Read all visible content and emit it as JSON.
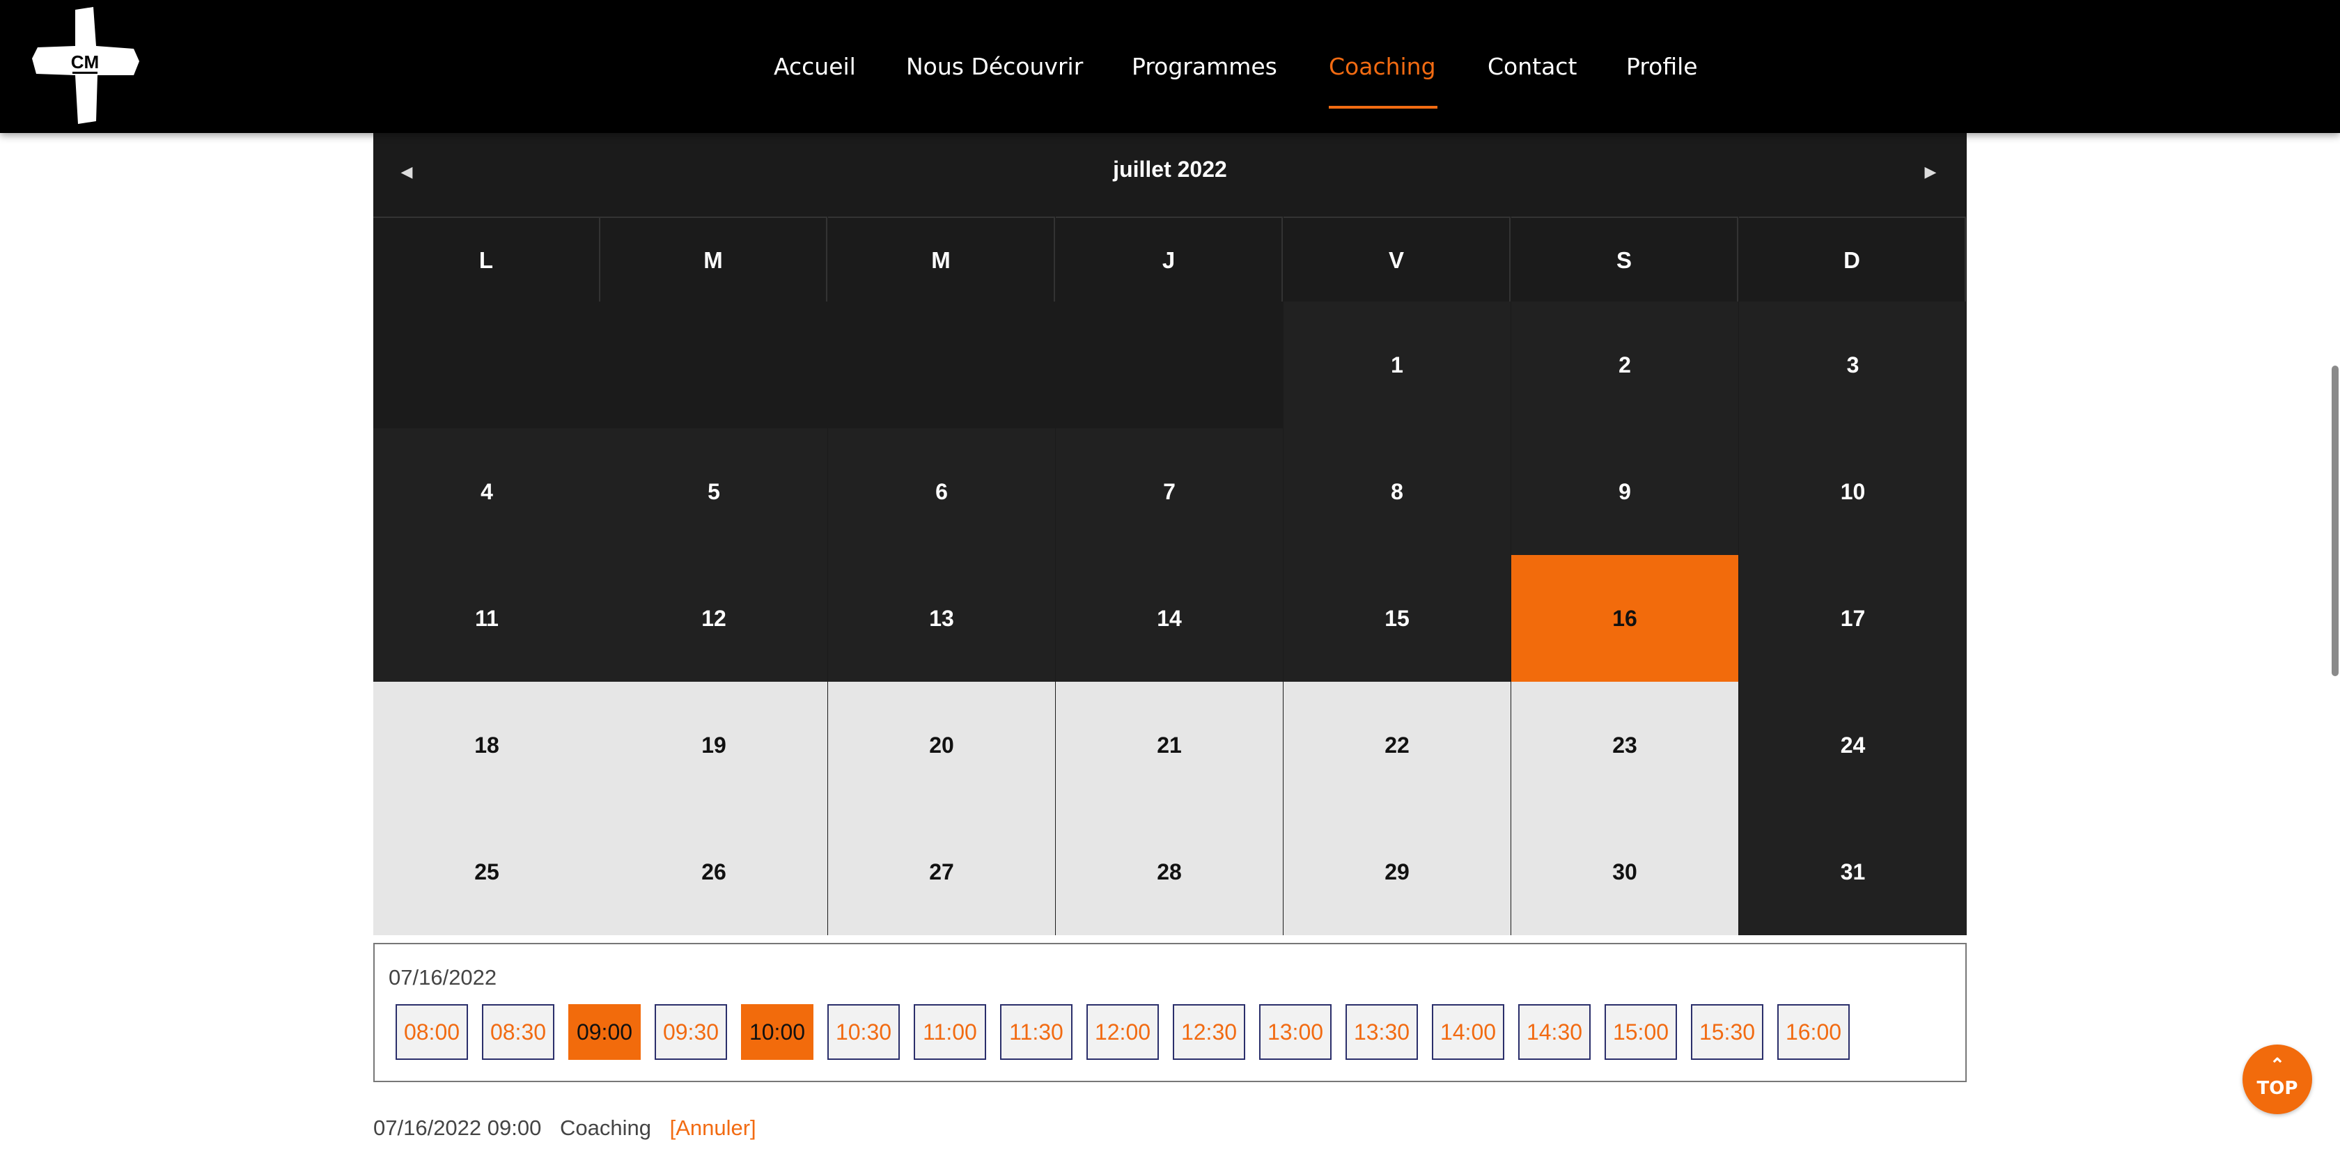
{
  "header": {
    "logo_text": "CM",
    "nav": [
      {
        "label": "Accueil"
      },
      {
        "label": "Nous Découvrir"
      },
      {
        "label": "Programmes"
      },
      {
        "label": "Coaching",
        "active": true
      },
      {
        "label": "Contact"
      },
      {
        "label": "Profile"
      }
    ]
  },
  "calendar": {
    "month_title": "juillet 2022",
    "prev_icon": "caret-left-icon",
    "next_icon": "caret-right-icon",
    "weekdays": [
      "L",
      "M",
      "M",
      "J",
      "V",
      "S",
      "D"
    ],
    "weeks": [
      [
        "",
        "",
        "",
        "",
        "1",
        "2",
        "3"
      ],
      [
        "4",
        "5",
        "6",
        "7",
        "8",
        "9",
        "10"
      ],
      [
        "11",
        "12",
        "13",
        "14",
        "15",
        "16",
        "17"
      ],
      [
        "18",
        "19",
        "20",
        "21",
        "22",
        "23",
        "24"
      ],
      [
        "25",
        "26",
        "27",
        "28",
        "29",
        "30",
        "31"
      ]
    ],
    "selected_day": "16",
    "accent_color": "#f26b0c"
  },
  "slots": {
    "date": "07/16/2022",
    "times": [
      "08:00",
      "08:30",
      "09:00",
      "09:30",
      "10:00",
      "10:30",
      "11:00",
      "11:30",
      "12:00",
      "12:30",
      "13:00",
      "13:30",
      "14:00",
      "14:30",
      "15:00",
      "15:30",
      "16:00"
    ],
    "booked": [
      "09:00",
      "10:00"
    ]
  },
  "booking": {
    "datetime": "07/16/2022 09:00",
    "type": "Coaching",
    "cancel_label": "[Annuler]"
  },
  "top_button": {
    "icon": "double-chevron-up-icon",
    "label": "TOP"
  }
}
